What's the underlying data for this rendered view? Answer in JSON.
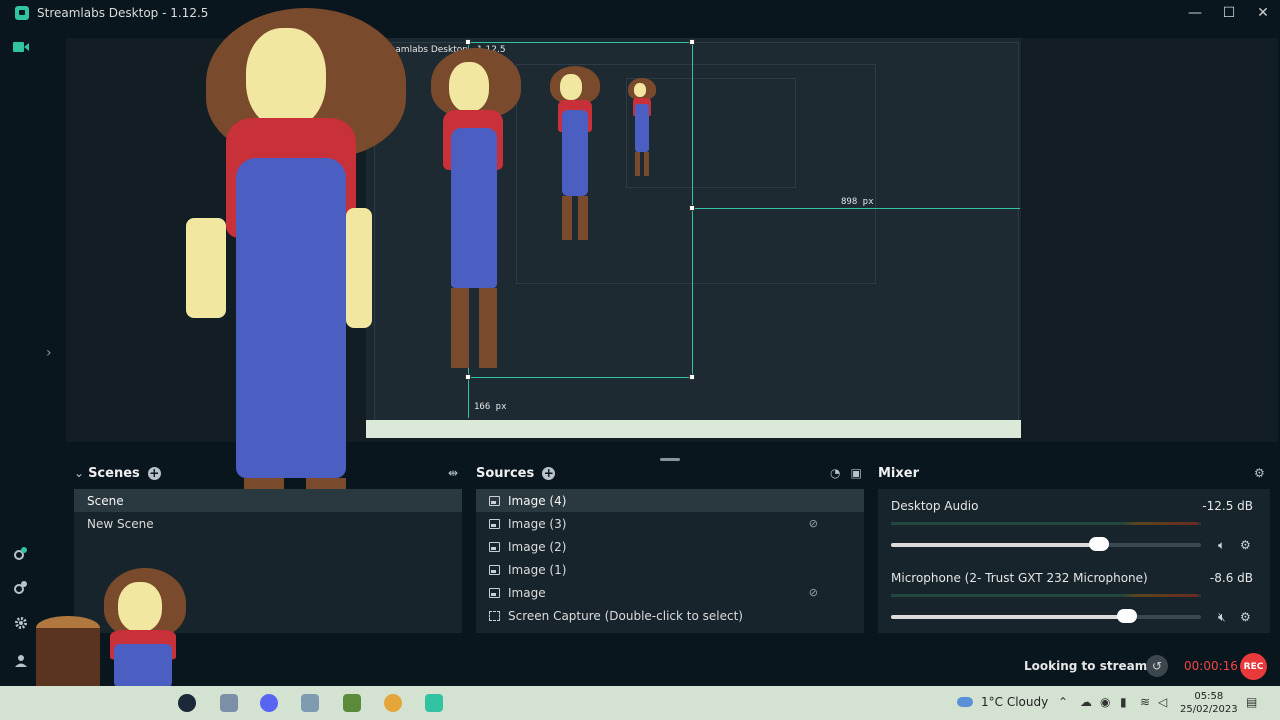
{
  "window": {
    "title": "Streamlabs Desktop - 1.12.5",
    "minimize": "—",
    "maximize": "☐",
    "close": "✕"
  },
  "preview": {
    "nested_title": "Streamlabs Desktop - 1.12.5",
    "guide_width_label": "898 px",
    "guide_height_label": "166 px"
  },
  "scenes": {
    "title": "Scenes",
    "items": [
      {
        "label": "Scene",
        "selected": true
      },
      {
        "label": "New Scene",
        "selected": false
      }
    ]
  },
  "sources": {
    "title": "Sources",
    "items": [
      {
        "label": "Image (4)",
        "type": "image",
        "hidden": false,
        "selected": true
      },
      {
        "label": "Image (3)",
        "type": "image",
        "hidden": true,
        "selected": false
      },
      {
        "label": "Image (2)",
        "type": "image",
        "hidden": false,
        "selected": false
      },
      {
        "label": "Image (1)",
        "type": "image",
        "hidden": false,
        "selected": false
      },
      {
        "label": "Image",
        "type": "image",
        "hidden": true,
        "selected": false
      },
      {
        "label": "Screen Capture (Double-click to select)",
        "type": "capture",
        "hidden": false,
        "selected": false
      }
    ]
  },
  "mixer": {
    "title": "Mixer",
    "channels": [
      {
        "name": "Desktop Audio",
        "db": "-12.5 dB",
        "level": 0.67,
        "muted": false
      },
      {
        "name": "Microphone (2- Trust GXT 232 Microphone)",
        "db": "-8.6 dB",
        "level": 0.76,
        "muted": true
      }
    ]
  },
  "footer": {
    "looking": "Looking to stream?",
    "timer": "00:00:16",
    "rec": "REC"
  },
  "taskbar": {
    "weather": "1°C  Cloudy",
    "time": "05:58",
    "date": "25/02/2023"
  },
  "colors": {
    "accent": "#31c3a2",
    "rec": "#e8393b",
    "background": "#09161d"
  }
}
